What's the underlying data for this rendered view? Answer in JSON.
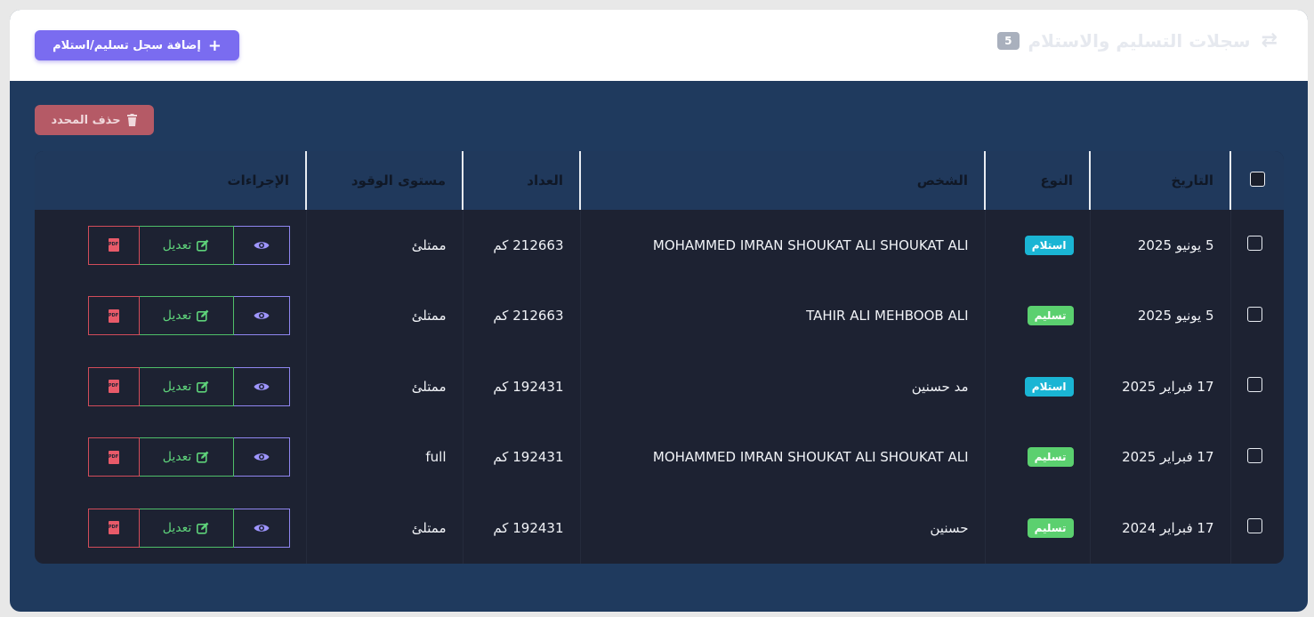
{
  "header": {
    "title": "سجلات التسليم والاستلام",
    "count": "5",
    "add_button_label": "إضافة سجل تسليم/استلام"
  },
  "toolbar": {
    "delete_selected_label": "حذف المحدد"
  },
  "table": {
    "columns": [
      "التاريخ",
      "النوع",
      "الشخص",
      "العداد",
      "مستوى الوقود",
      "الإجراءات"
    ],
    "edit_label": "تعديل",
    "pdf_label": "PDF",
    "rows": [
      {
        "date": "5 يونيو 2025",
        "type": "استلام",
        "type_color": "#1ab5d4",
        "person": "MOHAMMED IMRAN SHOUKAT ALI SHOUKAT ALI",
        "odometer": "212663 كم",
        "fuel": "ممتلئ"
      },
      {
        "date": "5 يونيو 2025",
        "type": "تسليم",
        "type_color": "#5bd06f",
        "person": "TAHIR ALI MEHBOOB ALI",
        "odometer": "212663 كم",
        "fuel": "ممتلئ"
      },
      {
        "date": "17 فبراير 2025",
        "type": "استلام",
        "type_color": "#1ab5d4",
        "person": "مد حسنين",
        "odometer": "192431 كم",
        "fuel": "ممتلئ"
      },
      {
        "date": "17 فبراير 2025",
        "type": "تسليم",
        "type_color": "#5bd06f",
        "person": "MOHAMMED IMRAN SHOUKAT ALI SHOUKAT ALI",
        "odometer": "192431 كم",
        "fuel": "full"
      },
      {
        "date": "17 فبراير 2024",
        "type": "تسليم",
        "type_color": "#5bd06f",
        "person": "حسنين",
        "odometer": "192431 كم",
        "fuel": "ممتلئ"
      }
    ]
  },
  "colors": {
    "primary": "#7a6cf0",
    "danger": "#b55a66",
    "panel": "#1f3a5e",
    "table_body": "#1d2232"
  },
  "icons": [
    "swap-icon",
    "plus-icon",
    "trash-icon",
    "eye-icon",
    "edit-icon",
    "pdf-icon"
  ]
}
